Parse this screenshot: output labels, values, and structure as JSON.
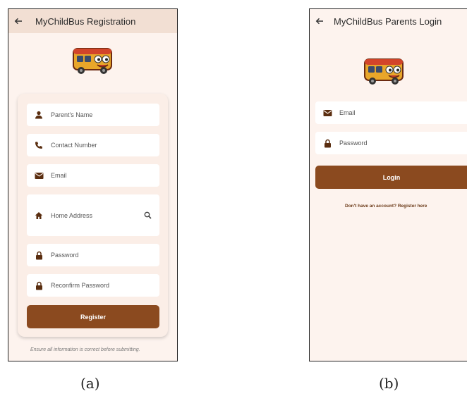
{
  "registration": {
    "title": "MyChildBus Registration",
    "fields": [
      {
        "label": "Parent's Name",
        "icon": "person-icon"
      },
      {
        "label": "Contact Number",
        "icon": "phone-icon"
      },
      {
        "label": "Email",
        "icon": "mail-icon"
      },
      {
        "label": "Home Address",
        "icon": "home-icon",
        "trailing_icon": "search-icon"
      },
      {
        "label": "Password",
        "icon": "lock-icon"
      },
      {
        "label": "Reconfirm Password",
        "icon": "lock-icon"
      }
    ],
    "register_button": "Register",
    "footnote": "Ensure all information is correct before submitting."
  },
  "login": {
    "title": "MyChildBus Parents Login",
    "fields": [
      {
        "label": "Email",
        "icon": "mail-icon"
      },
      {
        "label": "Password",
        "icon": "lock-icon"
      }
    ],
    "login_button": "Login",
    "register_link": "Don't have an account? Register here"
  },
  "captions": [
    "(a)",
    "(b)"
  ],
  "colors": {
    "accent": "#8b4a1f",
    "page_background": "#fdf3ee",
    "app_bar_registration": "#f2dfd3",
    "field_background": "#ffffff",
    "icon": "#5a2e10"
  }
}
